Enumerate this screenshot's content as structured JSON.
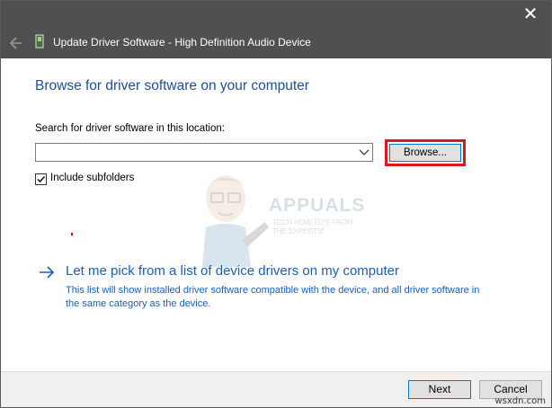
{
  "window": {
    "close_glyph": "✕"
  },
  "header": {
    "title": "Update Driver Software - High Definition Audio Device",
    "back_icon": "back-arrow-icon",
    "device_icon": "audio-device-icon"
  },
  "main": {
    "heading": "Browse for driver software on your computer",
    "search_label": "Search for driver software in this location:",
    "path_value": "",
    "browse_label": "Browse...",
    "include_subfolders_label": "Include subfolders",
    "include_subfolders_checked": true,
    "pick_title": "Let me pick from a list of device drivers on my computer",
    "pick_description": "This list will show installed driver software compatible with the device, and all driver software in the same category as the device."
  },
  "watermark": {
    "name": "APPUALS",
    "tagline_1": "TECH HOW-TO'S FROM",
    "tagline_2": "THE EXPERTS!"
  },
  "footer": {
    "next_label": "Next",
    "cancel_label": "Cancel",
    "site_mark": "wsxdn.com"
  },
  "colors": {
    "header_bg": "#505050",
    "heading_blue": "#1e4f9a",
    "link_blue": "#1b5fb5",
    "highlight_red": "#d8191f",
    "focus_border": "#0078d7"
  }
}
